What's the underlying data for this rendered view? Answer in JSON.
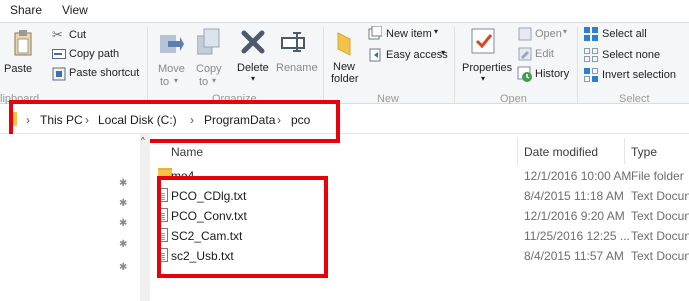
{
  "tabs": {
    "share": "Share",
    "view": "View"
  },
  "ribbon": {
    "clipboard": {
      "paste": "Paste",
      "cut": "Cut",
      "copy_path": "Copy path",
      "paste_shortcut": "Paste shortcut",
      "group": "lipboard"
    },
    "organize": {
      "move_to": "Move",
      "move_to_sub": "to",
      "copy_to": "Copy",
      "copy_to_sub": "to",
      "delete": "Delete",
      "rename": "Rename",
      "group": "Organize"
    },
    "new": {
      "new_folder_1": "New",
      "new_folder_2": "folder",
      "new_item": "New item",
      "easy_access": "Easy access",
      "group": "New"
    },
    "open": {
      "properties": "Properties",
      "open": "Open",
      "edit": "Edit",
      "history": "History",
      "group": "Open"
    },
    "select": {
      "select_all": "Select all",
      "select_none": "Select none",
      "invert_selection": "Invert selection",
      "group": "Select"
    }
  },
  "address": {
    "crumbs": [
      "This PC",
      "Local Disk (C:)",
      "ProgramData",
      "pco"
    ]
  },
  "columns": {
    "name": "Name",
    "date_modified": "Date modified",
    "type": "Type"
  },
  "files": [
    {
      "name": "me4",
      "date": "12/1/2016 10:00 AM",
      "type": "File folder"
    },
    {
      "name": "PCO_CDlg.txt",
      "date": "8/4/2015 11:18 AM",
      "type": "Text Docun"
    },
    {
      "name": "PCO_Conv.txt",
      "date": "12/1/2016 9:20 AM",
      "type": "Text Docun"
    },
    {
      "name": "SC2_Cam.txt",
      "date": "11/25/2016 12:25 ...",
      "type": "Text Docun"
    },
    {
      "name": "sc2_Usb.txt",
      "date": "8/4/2015 11:57 AM",
      "type": "Text Docun"
    }
  ],
  "colors": {
    "highlight": "#e8000b",
    "accent": "#1e73be"
  }
}
